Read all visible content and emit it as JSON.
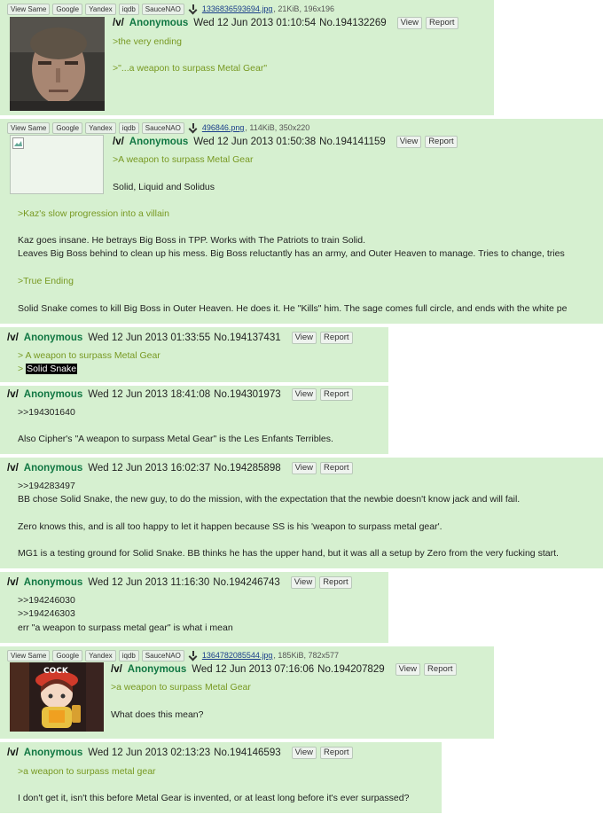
{
  "search_buttons": [
    "View Same",
    "Google",
    "Yandex",
    "iqdb",
    "SauceNAO"
  ],
  "posts": [
    {
      "board": "/v/",
      "name": "Anonymous",
      "date": "Wed 12 Jun 2013 01:10:54",
      "no": "No.194132269",
      "view": "View",
      "report": "Report",
      "file": {
        "name": "1336836593694.jpg",
        "meta": ", 21KiB, 196x196"
      },
      "lines": [
        ">the very ending",
        ">\"...a weapon to surpass Metal Gear\""
      ]
    },
    {
      "board": "/v/",
      "name": "Anonymous",
      "date": "Wed 12 Jun 2013 01:50:38",
      "no": "No.194141159",
      "view": "View",
      "report": "Report",
      "file": {
        "name": "496846.png",
        "meta": ", 114KiB, 350x220"
      },
      "lines": [
        ">A weapon to surpass Metal Gear",
        "Solid, Liquid and Solidus",
        ">Kaz's slow progression into a villain",
        "Kaz goes insane. He betrays Big Boss in TPP. Works with The Patriots to train Solid.",
        "Leaves Big Boss behind to clean up his mess. Big Boss reluctantly has an army, and Outer Heaven to manage. Tries to change, tries",
        ">True Ending",
        "Solid Snake comes to kill Big Boss in Outer Heaven. He does it. He \"Kills\" him. The sage comes full circle, and ends with the white pe"
      ]
    },
    {
      "board": "/v/",
      "name": "Anonymous",
      "date": "Wed 12 Jun 2013 01:33:55",
      "no": "No.194137431",
      "view": "View",
      "report": "Report",
      "lines": [
        "> A weapon to surpass Metal Gear",
        "> ",
        "Solid Snake"
      ]
    },
    {
      "board": "/v/",
      "name": "Anonymous",
      "date": "Wed 12 Jun 2013 18:41:08",
      "no": "No.194301973",
      "view": "View",
      "report": "Report",
      "lines": [
        ">>194301640",
        "Also Cipher's \"A weapon to surpass Metal Gear\" is the Les Enfants Terribles."
      ]
    },
    {
      "board": "/v/",
      "name": "Anonymous",
      "date": "Wed 12 Jun 2013 16:02:37",
      "no": "No.194285898",
      "view": "View",
      "report": "Report",
      "lines": [
        ">>194283497",
        "BB chose Solid Snake, the new guy, to do the mission, with the expectation that the newbie doesn't know jack and will fail.",
        "Zero knows this, and is all too happy to let it happen because SS is his 'weapon to surpass metal gear'.",
        "MG1 is a testing ground for Solid Snake. BB thinks he has the upper hand, but it was all a setup by Zero from the very fucking start."
      ]
    },
    {
      "board": "/v/",
      "name": "Anonymous",
      "date": "Wed 12 Jun 2013 11:16:30",
      "no": "No.194246743",
      "view": "View",
      "report": "Report",
      "lines": [
        ">>194246030",
        ">>194246303",
        "err \"a weapon to surpass metal gear\" is what i mean"
      ]
    },
    {
      "board": "/v/",
      "name": "Anonymous",
      "date": "Wed 12 Jun 2013 07:16:06",
      "no": "No.194207829",
      "view": "View",
      "report": "Report",
      "file": {
        "name": "1364782085544.jpg",
        "meta": ", 185KiB, 782x577"
      },
      "thumb_text": "COCK",
      "lines": [
        ">a weapon to surpass Metal Gear",
        "What does this mean?"
      ]
    },
    {
      "board": "/v/",
      "name": "Anonymous",
      "date": "Wed 12 Jun 2013 02:13:23",
      "no": "No.194146593",
      "view": "View",
      "report": "Report",
      "lines": [
        ">a weapon to surpass metal gear",
        "I don't get it, isn't this before Metal Gear is invented, or at least long before it's ever surpassed?"
      ]
    }
  ]
}
